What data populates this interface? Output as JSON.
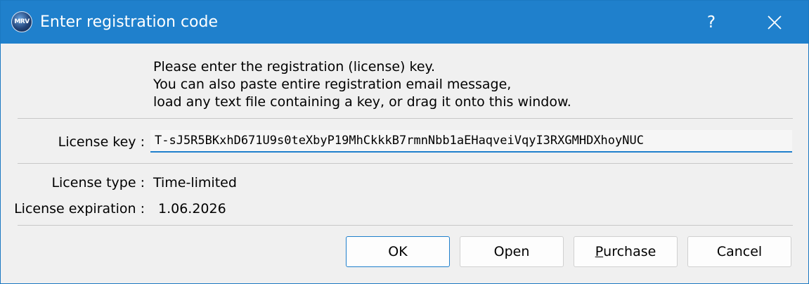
{
  "window": {
    "title": "Enter registration code",
    "app_icon_text": "MRV",
    "help_label": "?",
    "accent_color": "#1f80cc"
  },
  "instructions": {
    "line1": "Please enter the registration (license) key.",
    "line2": "You can also paste entire registration email message,",
    "line3": "load any text file containing a key, or drag it onto this window."
  },
  "license_key": {
    "label": "License key :",
    "value": "T-sJ5R5BKxhD671U9s0teXbyP19MhCkkkB7rmnNbb1aEHaqveiVqyI3RXGMHDXhoyNUC"
  },
  "license_type": {
    "label": "License type :",
    "value": "Time-limited"
  },
  "license_expiration": {
    "label": "License expiration :",
    "value": "1.06.2026"
  },
  "buttons": {
    "ok": "OK",
    "open": "Open",
    "purchase_first": "P",
    "purchase_rest": "urchase",
    "cancel": "Cancel"
  }
}
